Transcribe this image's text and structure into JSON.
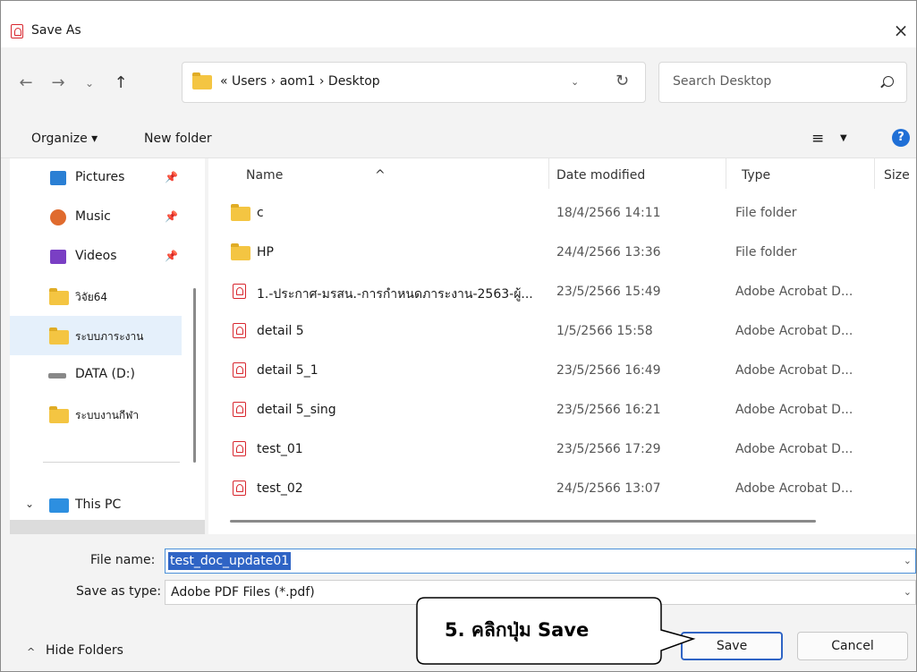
{
  "window": {
    "title": "Save As",
    "close_label": "×"
  },
  "nav": {
    "back": "←",
    "forward": "→",
    "recent": "⌄",
    "up": "↑"
  },
  "address": {
    "path": "«  Users  ›  aom1  ›  Desktop",
    "dropdown": "⌄",
    "refresh": "↻"
  },
  "search": {
    "placeholder": "Search Desktop"
  },
  "toolbar": {
    "organize_label": "Organize ▾",
    "new_folder_label": "New folder",
    "view_icon": "≡",
    "view_dropdown": "▼",
    "help_label": "?"
  },
  "sidebar": {
    "items": [
      {
        "label": "Pictures",
        "icon": "pictures-icon",
        "pinned": true
      },
      {
        "label": "Music",
        "icon": "music-icon",
        "pinned": true
      },
      {
        "label": "Videos",
        "icon": "videos-icon",
        "pinned": true
      },
      {
        "label": "วิจัย64",
        "icon": "folder-icon",
        "pinned": false
      },
      {
        "label": "ระบบภาระงาน",
        "icon": "folder-icon",
        "pinned": false,
        "selected": true
      },
      {
        "label": "DATA (D:)",
        "icon": "drive-icon",
        "pinned": false
      },
      {
        "label": "ระบบงานกีฬา",
        "icon": "folder-icon",
        "pinned": false
      },
      {
        "label": "This PC",
        "icon": "pc-icon",
        "pinned": false
      }
    ],
    "pin_glyph": "📌"
  },
  "files": {
    "columns": [
      "Name",
      "Date modified",
      "Type",
      "Size"
    ],
    "rows": [
      {
        "name": "c",
        "date": "18/4/2566 14:11",
        "type": "File folder",
        "kind": "folder"
      },
      {
        "name": "HP",
        "date": "24/4/2566 13:36",
        "type": "File folder",
        "kind": "folder"
      },
      {
        "name": "1.-ประกาศ-มรสน.-การกำหนดภาระงาน-2563-ผู้...",
        "date": "23/5/2566 15:49",
        "type": "Adobe Acrobat D...",
        "kind": "pdf"
      },
      {
        "name": "detail 5",
        "date": "1/5/2566 15:58",
        "type": "Adobe Acrobat D...",
        "kind": "pdf"
      },
      {
        "name": "detail 5_1",
        "date": "23/5/2566 16:49",
        "type": "Adobe Acrobat D...",
        "kind": "pdf"
      },
      {
        "name": "detail 5_sing",
        "date": "23/5/2566 16:21",
        "type": "Adobe Acrobat D...",
        "kind": "pdf"
      },
      {
        "name": "test_01",
        "date": "23/5/2566 17:29",
        "type": "Adobe Acrobat D...",
        "kind": "pdf"
      },
      {
        "name": "test_02",
        "date": "24/5/2566 13:07",
        "type": "Adobe Acrobat D...",
        "kind": "pdf"
      }
    ]
  },
  "form": {
    "file_name_label": "File name:",
    "file_name_value": "test_doc_update01",
    "save_type_label": "Save as type:",
    "save_type_value": "Adobe PDF Files (*.pdf)",
    "dropdown_glyph": "⌄"
  },
  "footer": {
    "hide_folders_label": "Hide Folders",
    "hide_folders_chevron": "^",
    "save_label": "Save",
    "cancel_label": "Cancel"
  },
  "annotation": {
    "text": "5. คลิกปุ่ม Save"
  }
}
